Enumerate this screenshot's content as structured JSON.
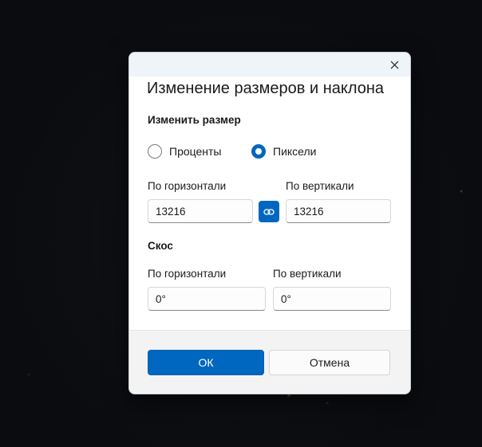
{
  "dialog": {
    "title": "Изменение размеров и наклона",
    "close_icon": "close-icon"
  },
  "resize": {
    "label": "Изменить размер",
    "options": [
      {
        "label": "Проценты",
        "checked": false
      },
      {
        "label": "Пиксели",
        "checked": true
      }
    ],
    "horizontal_label": "По горизонтали",
    "vertical_label": "По вертикали",
    "horizontal_value": "13216",
    "vertical_value": "13216",
    "link_icon": "link-icon"
  },
  "skew": {
    "label": "Скос",
    "horizontal_label": "По горизонтали",
    "vertical_label": "По вертикали",
    "horizontal_value": "0°",
    "vertical_value": "0°"
  },
  "footer": {
    "ok_label": "ОК",
    "cancel_label": "Отмена"
  },
  "colors": {
    "accent": "#0067c0"
  }
}
